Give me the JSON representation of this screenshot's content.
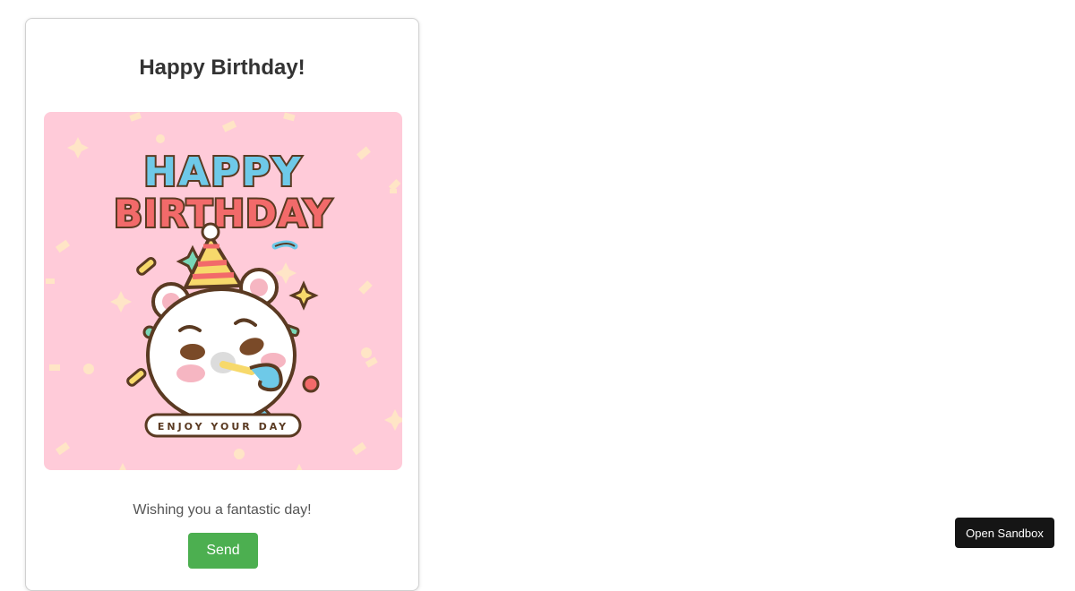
{
  "card": {
    "title": "Happy Birthday!",
    "image": {
      "line1": "HAPPY",
      "line2": "BIRTHDAY",
      "ribbon": "ENJOY YOUR DAY",
      "background_color": "#ffcbd9"
    },
    "message": "Wishing you a fantastic day!",
    "send_label": "Send"
  },
  "sandbox": {
    "label": "Open Sandbox"
  },
  "colors": {
    "send_button": "#4caf50",
    "sandbox_button": "#151515"
  }
}
